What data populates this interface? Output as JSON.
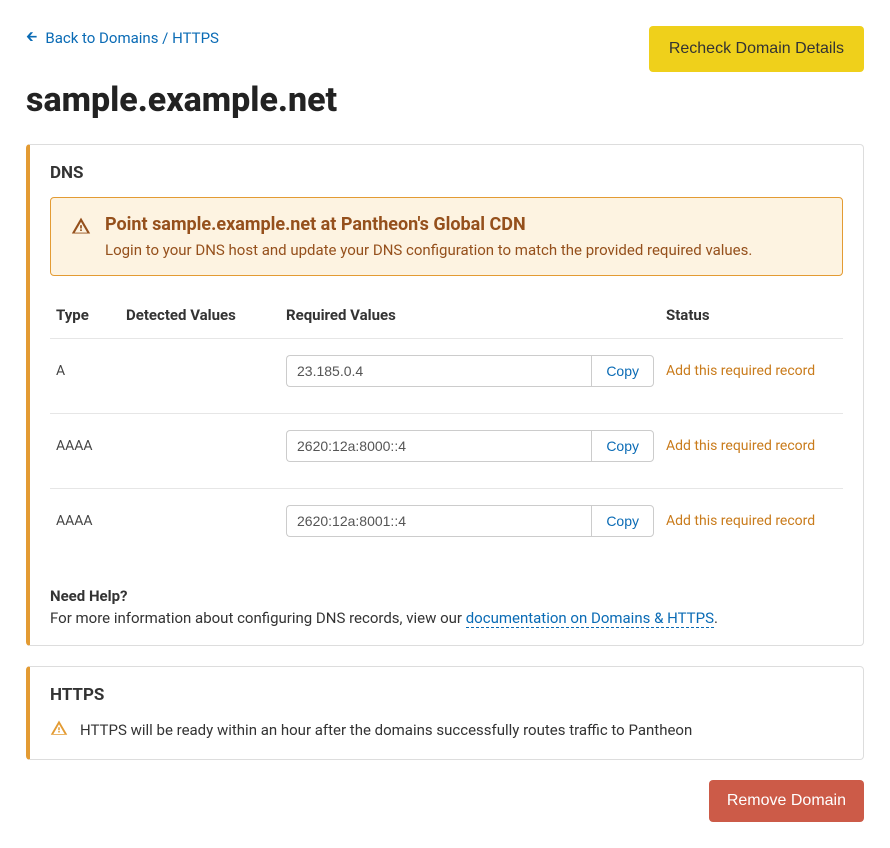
{
  "header": {
    "back_label": "Back to Domains / HTTPS",
    "recheck_label": "Recheck Domain Details",
    "domain_title": "sample.example.net"
  },
  "dns_card": {
    "title": "DNS",
    "alert": {
      "title": "Point sample.example.net at Pantheon's Global CDN",
      "body": "Login to your DNS host and update your DNS configuration to match the provided required values."
    },
    "columns": {
      "type": "Type",
      "detected": "Detected Values",
      "required": "Required Values",
      "status": "Status"
    },
    "copy_label": "Copy",
    "rows": [
      {
        "type": "A",
        "detected": "",
        "required": "23.185.0.4",
        "status": "Add this required record"
      },
      {
        "type": "AAAA",
        "detected": "",
        "required": "2620:12a:8000::4",
        "status": "Add this required record"
      },
      {
        "type": "AAAA",
        "detected": "",
        "required": "2620:12a:8001::4",
        "status": "Add this required record"
      }
    ],
    "help": {
      "title": "Need Help?",
      "body_prefix": "For more information about configuring DNS records, view our ",
      "link_text": "documentation on Domains & HTTPS",
      "body_suffix": "."
    }
  },
  "https_card": {
    "title": "HTTPS",
    "message": "HTTPS will be ready within an hour after the domains successfully routes traffic to Pantheon"
  },
  "footer": {
    "remove_label": "Remove Domain"
  }
}
